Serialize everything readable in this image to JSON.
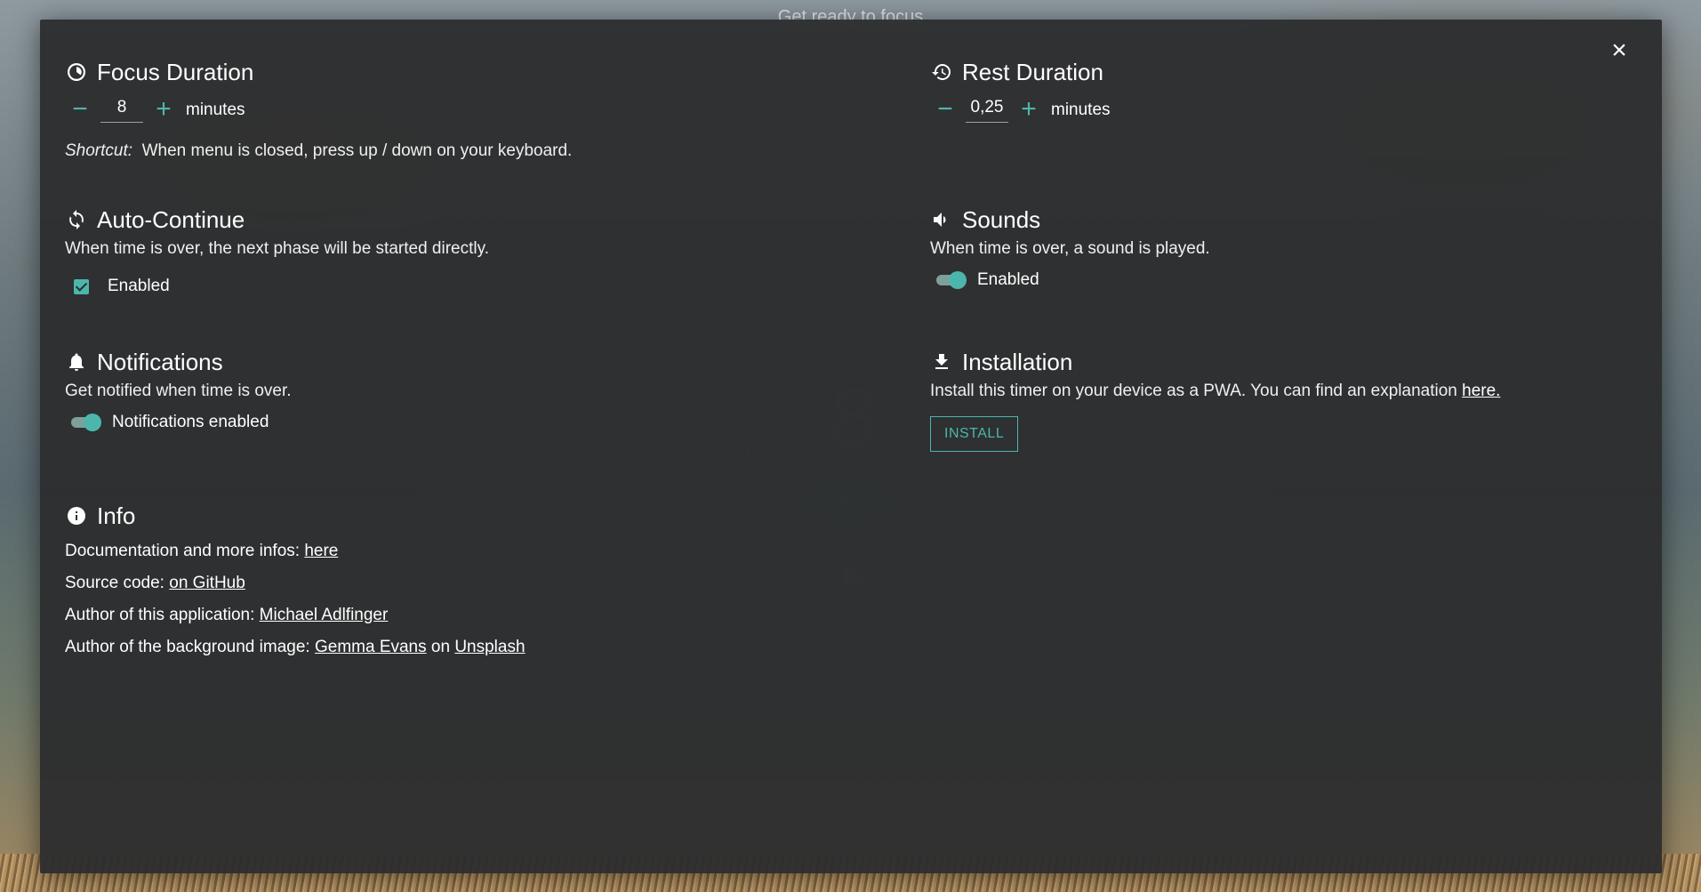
{
  "background": {
    "title": "Get ready to focus",
    "timer_minutes": "8",
    "timer_seconds": "00"
  },
  "settings": {
    "close_label": "×",
    "focus": {
      "title": "Focus Duration",
      "value": "8",
      "unit": "minutes",
      "minus_label": "−",
      "plus_label": "+",
      "shortcut_label": "Shortcut:",
      "shortcut_text": "When menu is closed, press up / down on your keyboard."
    },
    "rest": {
      "title": "Rest Duration",
      "value": "0,25",
      "unit": "minutes",
      "minus_label": "−",
      "plus_label": "+"
    },
    "auto_continue": {
      "title": "Auto-Continue",
      "description": "When time is over, the next phase will be started directly.",
      "checkbox_label": "Enabled",
      "checked": true
    },
    "sounds": {
      "title": "Sounds",
      "description": "When time is over, a sound is played.",
      "toggle_label": "Enabled",
      "on": true
    },
    "notifications": {
      "title": "Notifications",
      "description": "Get notified when time is over.",
      "toggle_label": "Notifications enabled",
      "on": true
    },
    "installation": {
      "title": "Installation",
      "description": "Install this timer on your device as a PWA. You can find an explanation",
      "link_text": "here.",
      "button_label": "INSTALL"
    },
    "info": {
      "title": "Info",
      "docs_label": "Documentation and more infos:",
      "docs_link": "here",
      "source_label": "Source code:",
      "source_link": "on GitHub",
      "author_label": "Author of this application:",
      "author_link": "Michael Adlfinger",
      "bg_author_label": "Author of the background image:",
      "bg_author_link": "Gemma Evans",
      "bg_on": "on",
      "bg_site_link": "Unsplash"
    }
  },
  "colors": {
    "accent": "#4db6ac",
    "modal_bg": "#2c2d2e"
  }
}
